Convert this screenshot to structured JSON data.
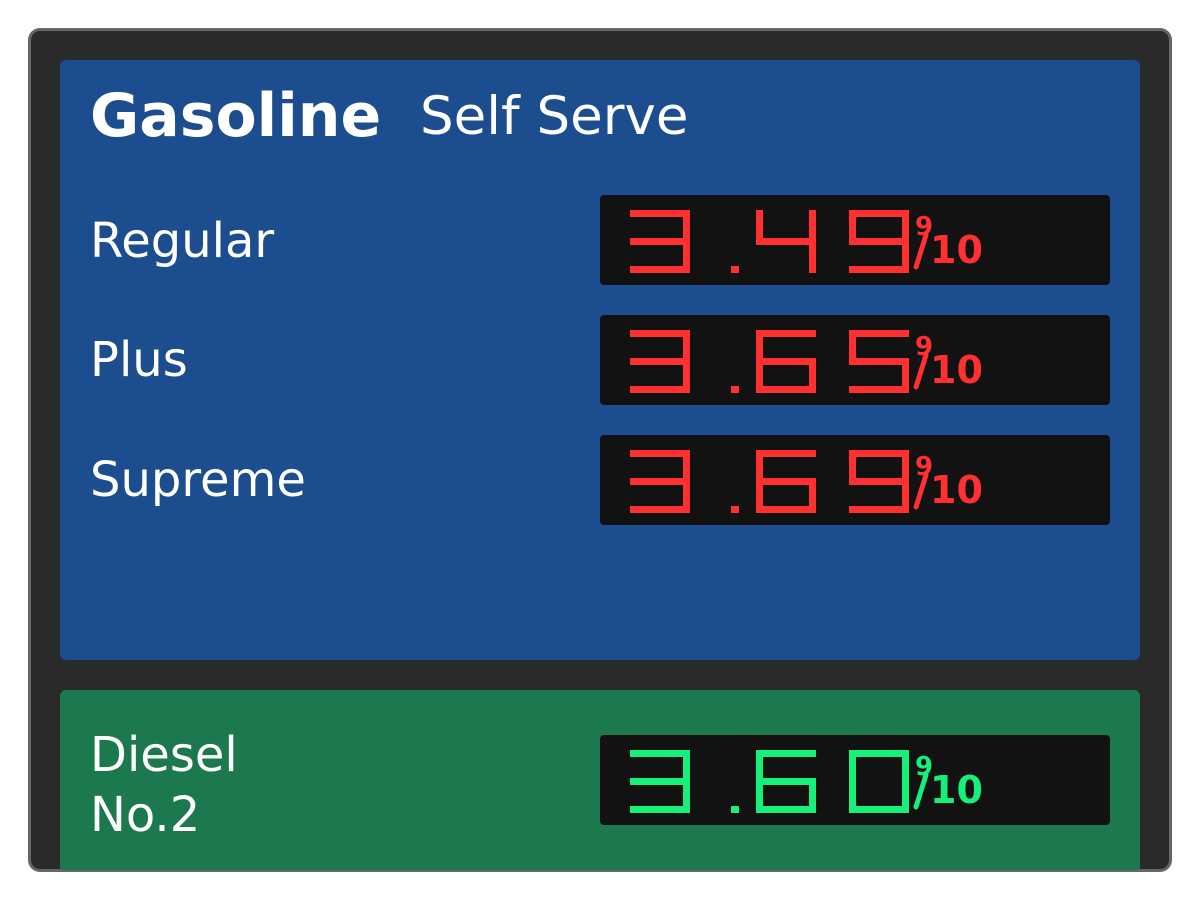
{
  "sign": {
    "frame_color": "#2a2a2a",
    "border_color": "#666666",
    "gasoline_panel_color": "#1c4d8e",
    "diesel_panel_color": "#1c794e",
    "led_red": "#ff3030",
    "led_green": "#14f07a",
    "display_bg": "#121212"
  },
  "gasoline": {
    "title": "Gasoline",
    "subtitle": "Self Serve",
    "grades": [
      {
        "label": "Regular",
        "price": "3.49",
        "fraction_num": "9",
        "fraction_den": "10"
      },
      {
        "label": "Plus",
        "price": "3.65",
        "fraction_num": "9",
        "fraction_den": "10"
      },
      {
        "label": "Supreme",
        "price": "3.69",
        "fraction_num": "9",
        "fraction_den": "10"
      }
    ]
  },
  "diesel": {
    "label_line1": "Diesel",
    "label_line2": "No.2",
    "price": "3.60",
    "fraction_num": "9",
    "fraction_den": "10"
  }
}
